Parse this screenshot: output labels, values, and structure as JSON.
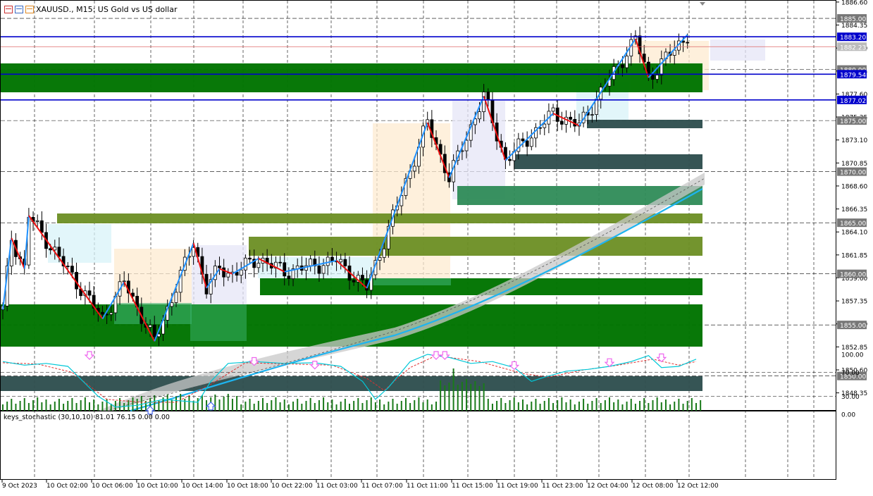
{
  "chart": {
    "symbol_line": "XAUUSD., M15:  US Gold vs US dollar",
    "header_icons": [
      "window-red-icon",
      "window-blue-icon",
      "window-orange-icon"
    ]
  },
  "price_axis": {
    "ticks": [
      "1886.60",
      "1884.35",
      "1882.10",
      "1879.85",
      "1877.60",
      "1875.35",
      "1873.10",
      "1870.85",
      "1868.60",
      "1866.35",
      "1864.10",
      "1861.85",
      "1859.60",
      "1857.35",
      "1855.10",
      "1852.85",
      "1850.60",
      "1848.35"
    ],
    "highlighted_labels": [
      {
        "text": "1885.00",
        "price": 1885.0,
        "kind": "round"
      },
      {
        "text": "1883.20",
        "price": 1883.2,
        "kind": "blue"
      },
      {
        "text": "1882.23",
        "price": 1882.23,
        "kind": "current"
      },
      {
        "text": "1880.00",
        "price": 1880.0,
        "kind": "round"
      },
      {
        "text": "1879.54",
        "price": 1879.54,
        "kind": "blue"
      },
      {
        "text": "1877.02",
        "price": 1877.02,
        "kind": "blue"
      },
      {
        "text": "1875.00",
        "price": 1875.0,
        "kind": "round"
      },
      {
        "text": "1870.00",
        "price": 1870.0,
        "kind": "round"
      },
      {
        "text": "1865.00",
        "price": 1865.0,
        "kind": "round"
      },
      {
        "text": "1860.00",
        "price": 1860.0,
        "kind": "round"
      },
      {
        "text": "1855.00",
        "price": 1855.0,
        "kind": "round"
      },
      {
        "text": "1850.00",
        "price": 1850.0,
        "kind": "round"
      }
    ]
  },
  "time_axis": {
    "labels": [
      "9 Oct 2023",
      "10 Oct 02:00",
      "10 Oct 06:00",
      "10 Oct 10:00",
      "10 Oct 14:00",
      "10 Oct 18:00",
      "10 Oct 22:00",
      "11 Oct 03:00",
      "11 Oct 07:00",
      "11 Oct 11:00",
      "11 Oct 15:00",
      "11 Oct 19:00",
      "11 Oct 23:00",
      "12 Oct 04:00",
      "12 Oct 08:00",
      "12 Oct 12:00"
    ]
  },
  "indicator": {
    "title": "keys_stochastic (30,10,10) 81.01 76.15 0.00 0.00",
    "levels": [
      "100.00",
      "70.00",
      "30.00",
      "0.00"
    ]
  },
  "colors": {
    "blue_line": "#0000cc",
    "current_price_line": "#d66",
    "zone_green": "#007400",
    "zone_olive": "#6b8e23",
    "zone_dark": "#2f4f4f",
    "ma_blue": "#1eb4f0",
    "zigzag_up": "#1e90ff",
    "zigzag_down": "#ee1111",
    "volume": "#1a7a1a",
    "stoch_main": "#00c8d8",
    "stoch_signal": "#e03030",
    "arrow_sell": "#ee66ee",
    "arrow_buy": "#4466ee"
  },
  "chart_data": {
    "type": "candlestick",
    "title": "XAUUSD., M15:  US Gold vs US dollar",
    "ylim": [
      1846.6,
      1886.8
    ],
    "horizontal_lines": [
      1883.2,
      1879.54,
      1877.02
    ],
    "current_price": 1882.23,
    "zigzag": [
      [
        0,
        1856.5
      ],
      [
        2,
        1863.5
      ],
      [
        5,
        1860.5
      ],
      [
        6,
        1865.7
      ],
      [
        23,
        1855.6
      ],
      [
        28,
        1859.2
      ],
      [
        35,
        1853.4
      ],
      [
        44,
        1863.0
      ],
      [
        47,
        1858.6
      ],
      [
        50,
        1860.5
      ],
      [
        53,
        1860.0
      ],
      [
        59,
        1861.5
      ],
      [
        65,
        1860.2
      ],
      [
        77,
        1861.3
      ],
      [
        84,
        1858.6
      ],
      [
        98,
        1874.8
      ],
      [
        103,
        1869.4
      ],
      [
        111,
        1877.4
      ],
      [
        116,
        1871.1
      ],
      [
        127,
        1875.7
      ],
      [
        133,
        1874.5
      ],
      [
        146,
        1883.0
      ],
      [
        149,
        1879.2
      ],
      [
        158,
        1883.4
      ]
    ],
    "stochastic_main": [
      [
        0,
        88
      ],
      [
        5,
        82
      ],
      [
        10,
        85
      ],
      [
        15,
        80
      ],
      [
        22,
        30
      ],
      [
        26,
        12
      ],
      [
        31,
        15
      ],
      [
        37,
        25
      ],
      [
        45,
        20
      ],
      [
        48,
        55
      ],
      [
        52,
        85
      ],
      [
        58,
        88
      ],
      [
        65,
        85
      ],
      [
        72,
        86
      ],
      [
        78,
        80
      ],
      [
        83,
        55
      ],
      [
        86,
        25
      ],
      [
        89,
        45
      ],
      [
        94,
        88
      ],
      [
        98,
        100
      ],
      [
        103,
        95
      ],
      [
        108,
        85
      ],
      [
        113,
        88
      ],
      [
        118,
        78
      ],
      [
        122,
        55
      ],
      [
        125,
        62
      ],
      [
        130,
        72
      ],
      [
        135,
        75
      ],
      [
        140,
        80
      ],
      [
        145,
        88
      ],
      [
        149,
        98
      ],
      [
        152,
        78
      ],
      [
        156,
        80
      ],
      [
        160,
        92
      ]
    ],
    "stochastic_signal": [
      [
        0,
        86
      ],
      [
        8,
        84
      ],
      [
        16,
        70
      ],
      [
        24,
        25
      ],
      [
        32,
        20
      ],
      [
        40,
        20
      ],
      [
        48,
        50
      ],
      [
        56,
        86
      ],
      [
        66,
        84
      ],
      [
        76,
        82
      ],
      [
        84,
        60
      ],
      [
        88,
        40
      ],
      [
        94,
        78
      ],
      [
        100,
        98
      ],
      [
        110,
        88
      ],
      [
        120,
        68
      ],
      [
        126,
        62
      ],
      [
        134,
        74
      ],
      [
        142,
        82
      ],
      [
        150,
        92
      ],
      [
        156,
        82
      ],
      [
        160,
        88
      ]
    ]
  }
}
